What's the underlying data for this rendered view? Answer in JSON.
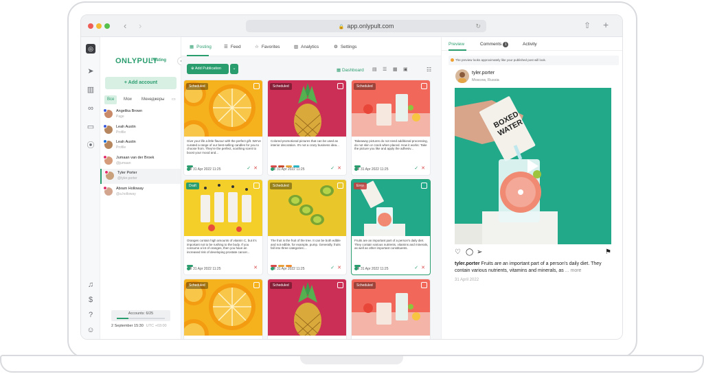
{
  "browser": {
    "url": "app.onlypult.com"
  },
  "brand": {
    "name": "ONLYPULT",
    "sub": "Posting"
  },
  "sidebar": {
    "add_account": "+ Add account",
    "filters": [
      "Все",
      "Мои",
      "Менеджеры"
    ],
    "accounts": [
      {
        "name": "Angelika Brown",
        "sub": "Page",
        "color": "#c98a6a",
        "badge": "#3b5bdb"
      },
      {
        "name": "Leah Austin",
        "sub": "Profile",
        "color": "#b6865e",
        "badge": "#3b5bdb"
      },
      {
        "name": "Leah Austin",
        "sub": "Profile",
        "color": "#b6865e",
        "badge": "#1d6fd8"
      },
      {
        "name": "Jumaan van der Broek",
        "sub": "@jumaan",
        "color": "#d59b7a",
        "badge": "#e1306c"
      },
      {
        "name": "Tyler Porter",
        "sub": "@tyler.porter",
        "color": "#c8a07c",
        "badge": "#e1306c"
      },
      {
        "name": "Abram Holloway",
        "sub": "@a.holloway",
        "color": "#d3a58e",
        "badge": "#e1306c"
      }
    ],
    "accounts_count": "Accounts: 6/25",
    "accounts_fill": 0.24,
    "date": "2 September 15:30",
    "timezone": "UTC +03:00"
  },
  "main": {
    "tabs": [
      {
        "label": "Posting",
        "icon": "calendar-icon"
      },
      {
        "label": "Feed",
        "icon": "feed-icon"
      },
      {
        "label": "Favorites",
        "icon": "star-icon"
      },
      {
        "label": "Analytics",
        "icon": "analytics-icon"
      },
      {
        "label": "Settings",
        "icon": "gear-icon"
      }
    ],
    "add_publication": "Add Publication",
    "view_label": "Dashboard",
    "cards": [
      {
        "status": "Scheduled",
        "image": "orange",
        "text": "Give your life a little flavour with the perfect gift. We've curated a range of our best-selling candles for you to choose from. They're the perfect, soothing scent to boost your mood and...",
        "date": "31 Apr 2022 11:25"
      },
      {
        "status": "Scheduled",
        "image": "pineapple",
        "text": "Colored promotional pictures that can be used as interior decoration. It's not a crazy business idea...",
        "date": "31 Apr 2022 11:25"
      },
      {
        "status": "Scheduled",
        "image": "juice",
        "text": "Takeaway pictures do not need additional processing, do not skin or crack when placed. How it works: Take the picture you like and apply the adhesiv...",
        "date": "31 Apr 2022 11:25"
      },
      {
        "status": "Draft",
        "image": "bottles",
        "text": "Oranges contain high amounts of vitamin C, but it's important not to be rushing to the body. If you consume a lot of oranges, then you have an increased risk of developing prostate cancer...",
        "date": "31 Apr 2022 11:25"
      },
      {
        "status": "Scheduled",
        "image": "kiwi",
        "text": "The fruit is the fruit of the tree. It can be both edible and not edible, for example, pump. Generally, fruits fall into three categories:...",
        "date": "31 Apr 2022 11:25"
      },
      {
        "status": "Error",
        "image": "juicegreen",
        "text": "Fruits are an important part of a person's daily diet. They contain various nutrients, vitamins and minerals, as well as other important constituents.",
        "date": "31 Apr 2022 11:25"
      },
      {
        "status": "Scheduled",
        "image": "orange",
        "text": "",
        "date": ""
      },
      {
        "status": "Scheduled",
        "image": "pineapple",
        "text": "",
        "date": ""
      },
      {
        "status": "Scheduled",
        "image": "juice",
        "text": "",
        "date": ""
      }
    ]
  },
  "preview": {
    "tabs": [
      "Preview",
      "Comments",
      "Activity"
    ],
    "comments_count": "1",
    "notice": "The preview looks approximately like your published post will look.",
    "username": "tyler.porter",
    "location": "Moscow, Russia",
    "caption_user": "tyler.porter",
    "caption": "Fruits are an important part of a person's daily diet. They contain various nutrients, vitamins and minerals, as",
    "more": "... more",
    "date": "31 April 2022"
  },
  "colors": {
    "accent": "#2a9d6e",
    "error": "#d94a4a",
    "preview_bg": "#21a98a"
  }
}
